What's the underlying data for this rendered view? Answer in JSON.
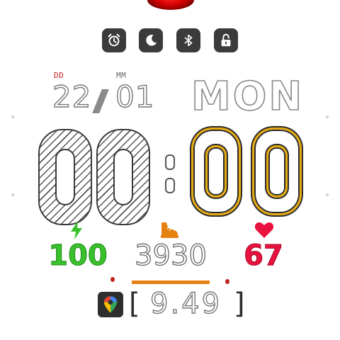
{
  "status_icons": [
    {
      "name": "alarm-icon"
    },
    {
      "name": "moon-icon"
    },
    {
      "name": "bluetooth-icon"
    },
    {
      "name": "lock-icon"
    }
  ],
  "date": {
    "day_label": "DD",
    "month_label": "MM",
    "day": "22",
    "month": "01",
    "weekday": "MON"
  },
  "time": {
    "hour_digits": [
      "0",
      "0"
    ],
    "minute_digits": [
      "0",
      "0"
    ]
  },
  "stats": {
    "battery": "100",
    "steps": "3930",
    "heart_rate": "67",
    "steps_progress": 0.39
  },
  "bottom": {
    "open_bracket": "[",
    "value": "9.49",
    "close_bracket": "]",
    "app_icon": "google-maps-icon"
  },
  "colors": {
    "battery": "#38c12c",
    "steps": "#e6810f",
    "heart": "#e8123f",
    "minutes": "#e7ab12",
    "day_label": "#c0201f"
  }
}
